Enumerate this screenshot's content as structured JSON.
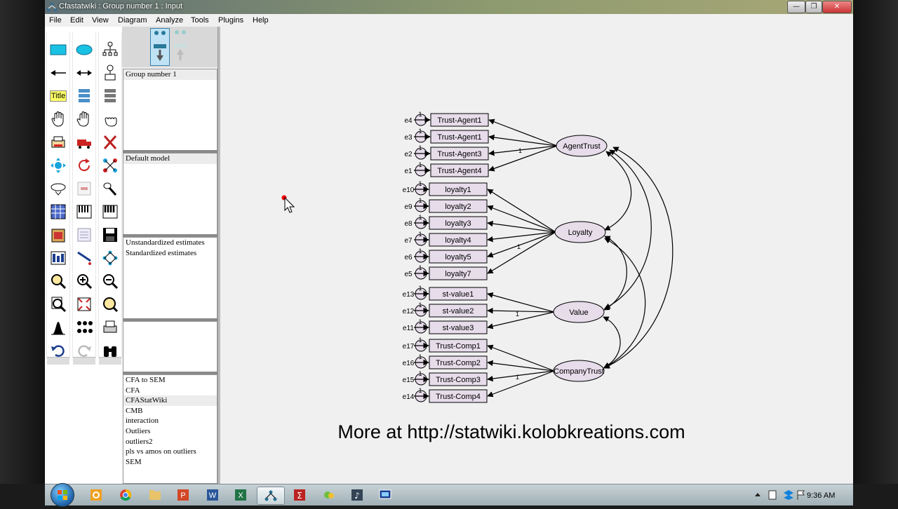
{
  "window": {
    "title": "Cfastatwiki : Group number 1 : Input"
  },
  "menu": [
    "File",
    "Edit",
    "View",
    "Diagram",
    "Analyze",
    "Tools",
    "Plugins",
    "Help"
  ],
  "toolbox": {
    "title_tool_label": "Title"
  },
  "panels": {
    "groups": [
      "Group number 1"
    ],
    "models": [
      "Default model"
    ],
    "estimates": [
      "Unstandardized estimates",
      "Standardized estimates"
    ],
    "files": [
      "CFA to SEM",
      "CFA",
      "CFAStatWiki",
      "CMB",
      "interaction",
      "Outliers",
      "outliers2",
      "pls vs amos on outliers",
      "SEM"
    ],
    "selected_file_index": 2
  },
  "diagram": {
    "constructs": [
      {
        "name": "AgentTrust",
        "items": [
          "Trust-Agent1",
          "Trust-Agent1",
          "Trust-Agent3",
          "Trust-Agent4"
        ],
        "errors": [
          "e4",
          "e3",
          "e2",
          "e1"
        ]
      },
      {
        "name": "Loyalty",
        "items": [
          "loyalty1",
          "loyalty2",
          "loyalty3",
          "loyalty4",
          "loyalty5",
          "loyalty7"
        ],
        "errors": [
          "e10",
          "e9",
          "e8",
          "e7",
          "e6",
          "e5"
        ]
      },
      {
        "name": "Value",
        "items": [
          "st-value1",
          "st-value2",
          "st-value3"
        ],
        "errors": [
          "e13",
          "e12",
          "e11"
        ]
      },
      {
        "name": "CompanyTrust",
        "items": [
          "Trust-Comp1",
          "Trust-Comp2",
          "Trust-Comp3",
          "Trust-Comp4"
        ],
        "errors": [
          "e17",
          "e16",
          "e15",
          "e14"
        ]
      }
    ],
    "fixed_label": "1",
    "footer_text": "More at http://statwiki.kolobkreations.com"
  },
  "taskbar": {
    "time": "9:36 AM"
  },
  "colors": {
    "node_fill": "#e6dcea",
    "titlebar": "#7f8d6f",
    "taskbar": "#b6c4ca"
  }
}
